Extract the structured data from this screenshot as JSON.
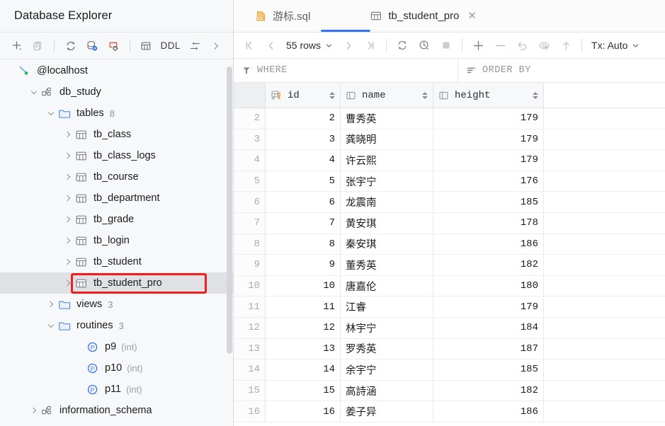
{
  "sidebar": {
    "title": "Database Explorer",
    "toolbar": [
      {
        "name": "add-icon",
        "label": "+"
      },
      {
        "name": "duplicate-icon",
        "label": ""
      },
      {
        "name": "refresh-icon",
        "label": ""
      },
      {
        "name": "database-settings-icon",
        "label": ""
      },
      {
        "name": "stop-query-icon",
        "label": ""
      },
      {
        "name": "table-icon",
        "label": ""
      },
      {
        "name": "ddl-button",
        "label": "DDL"
      },
      {
        "name": "collapse-all-icon",
        "label": ""
      },
      {
        "name": "expand-panel-icon",
        "label": ""
      }
    ],
    "tree": [
      {
        "label": "@localhost",
        "icon": "connection-icon",
        "arrow": "none",
        "indent": 8,
        "sub": "",
        "selected": false
      },
      {
        "label": "db_study",
        "icon": "schema-icon",
        "arrow": "down",
        "indent": 40,
        "sub": "",
        "selected": false
      },
      {
        "label": "tables",
        "icon": "folder-icon",
        "arrow": "down",
        "indent": 64,
        "sub": "8",
        "selected": false
      },
      {
        "label": "tb_class",
        "icon": "table-icon",
        "arrow": "right",
        "indent": 88,
        "sub": "",
        "selected": false
      },
      {
        "label": "tb_class_logs",
        "icon": "table-icon",
        "arrow": "right",
        "indent": 88,
        "sub": "",
        "selected": false
      },
      {
        "label": "tb_course",
        "icon": "table-icon",
        "arrow": "right",
        "indent": 88,
        "sub": "",
        "selected": false
      },
      {
        "label": "tb_department",
        "icon": "table-icon",
        "arrow": "right",
        "indent": 88,
        "sub": "",
        "selected": false
      },
      {
        "label": "tb_grade",
        "icon": "table-icon",
        "arrow": "right",
        "indent": 88,
        "sub": "",
        "selected": false
      },
      {
        "label": "tb_login",
        "icon": "table-icon",
        "arrow": "right",
        "indent": 88,
        "sub": "",
        "selected": false
      },
      {
        "label": "tb_student",
        "icon": "table-icon",
        "arrow": "right",
        "indent": 88,
        "sub": "",
        "selected": false
      },
      {
        "label": "tb_student_pro",
        "icon": "table-icon",
        "arrow": "right",
        "indent": 88,
        "sub": "",
        "selected": true
      },
      {
        "label": "views",
        "icon": "folder-icon",
        "arrow": "right",
        "indent": 64,
        "sub": "3",
        "selected": false
      },
      {
        "label": "routines",
        "icon": "folder-icon",
        "arrow": "down",
        "indent": 64,
        "sub": "3",
        "selected": false
      },
      {
        "label": "p9",
        "icon": "procedure-icon",
        "arrow": "none",
        "indent": 104,
        "paren": "(int)",
        "selected": false
      },
      {
        "label": "p10",
        "icon": "procedure-icon",
        "arrow": "none",
        "indent": 104,
        "paren": "(int)",
        "selected": false
      },
      {
        "label": "p11",
        "icon": "procedure-icon",
        "arrow": "none",
        "indent": 104,
        "paren": "(int)",
        "selected": false
      },
      {
        "label": "information_schema",
        "icon": "schema-icon",
        "arrow": "right",
        "indent": 40,
        "sub": "",
        "selected": false
      }
    ],
    "highlight_label": "tb_student_pro",
    "highlight_color": "#f01e1e"
  },
  "tabs": [
    {
      "label": "游标.sql",
      "icon": "sql-file-icon",
      "active": false,
      "closable": false
    },
    {
      "label": "tb_student_pro",
      "icon": "table-icon",
      "active": true,
      "closable": true,
      "close_glyph": "✕"
    }
  ],
  "grid_toolbar": {
    "first_page": "first-page-icon",
    "prev_page": "prev-page-icon",
    "rows_label": "55 rows",
    "next_page": "next-page-icon",
    "last_page": "last-page-icon",
    "refresh": "refresh-icon",
    "history": "history-icon",
    "stop": "stop-icon",
    "add_row": "add-row-icon",
    "delete_row": "delete-row-icon",
    "revert": "revert-icon",
    "preview": "preview-changes-icon",
    "submit": "submit-icon",
    "tx_label": "Tx: Auto"
  },
  "filters": {
    "where_label": "WHERE",
    "where_placeholder": "WHERE",
    "order_by_label": "ORDER BY",
    "order_by_placeholder": "ORDER BY"
  },
  "table": {
    "columns": [
      {
        "label": "",
        "name": "row-number-gutter",
        "icon": ""
      },
      {
        "label": "id",
        "name": "column-id",
        "icon": "primary-key-icon"
      },
      {
        "label": "name",
        "name": "column-name",
        "icon": "text-column-icon"
      },
      {
        "label": "height",
        "name": "column-height",
        "icon": "text-column-icon"
      }
    ],
    "rows": [
      {
        "n": "2",
        "id": "2",
        "name": "曹秀英",
        "height": "179"
      },
      {
        "n": "3",
        "id": "3",
        "name": "龚晓明",
        "height": "179"
      },
      {
        "n": "4",
        "id": "4",
        "name": "许云熙",
        "height": "179"
      },
      {
        "n": "5",
        "id": "5",
        "name": "张宇宁",
        "height": "176"
      },
      {
        "n": "6",
        "id": "6",
        "name": "龙震南",
        "height": "185"
      },
      {
        "n": "7",
        "id": "7",
        "name": "黄安琪",
        "height": "178"
      },
      {
        "n": "8",
        "id": "8",
        "name": "秦安琪",
        "height": "186"
      },
      {
        "n": "9",
        "id": "9",
        "name": "董秀英",
        "height": "182"
      },
      {
        "n": "10",
        "id": "10",
        "name": "唐嘉伦",
        "height": "180"
      },
      {
        "n": "11",
        "id": "11",
        "name": "江睿",
        "height": "179"
      },
      {
        "n": "12",
        "id": "12",
        "name": "林宇宁",
        "height": "184"
      },
      {
        "n": "13",
        "id": "13",
        "name": "罗秀英",
        "height": "187"
      },
      {
        "n": "14",
        "id": "14",
        "name": "余宇宁",
        "height": "185"
      },
      {
        "n": "15",
        "id": "15",
        "name": "高詩涵",
        "height": "182"
      },
      {
        "n": "16",
        "id": "16",
        "name": "姜子异",
        "height": "186"
      }
    ]
  },
  "colors": {
    "accent": "#3574f0",
    "selection": "#dfe1e5",
    "highlight": "#f01e1e",
    "sidebar_bg": "#f7f8fa"
  }
}
